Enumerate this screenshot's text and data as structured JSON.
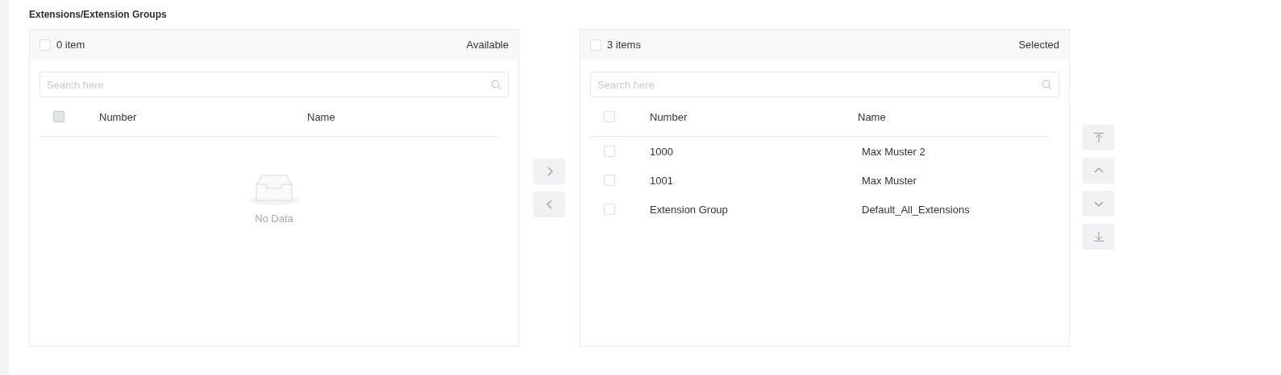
{
  "section_title": "Extensions/Extension Groups",
  "panels": [
    {
      "count": "0 item",
      "title": "Available",
      "checked": false,
      "search": {
        "placeholder": "Search here"
      },
      "columns": [
        "Number",
        "Name"
      ],
      "header_checkbox": {
        "checked": false,
        "disabled": true
      },
      "empty_text": "No Data"
    },
    {
      "count": "3 items",
      "title": "Selected",
      "checked": false,
      "search": {
        "placeholder": "Search here"
      },
      "columns": [
        "Number",
        "Name"
      ],
      "header_checkbox": {
        "checked": false,
        "disabled": false
      },
      "rows": [
        {
          "number": "1000",
          "name": "Max Muster 2",
          "checked": false
        },
        {
          "number": "1001",
          "name": "Max Muster",
          "checked": false
        },
        {
          "number": "Extension Group",
          "name": "Default_All_Extensions",
          "checked": false
        }
      ]
    }
  ],
  "transfer_buttons": [
    {
      "kind": "right",
      "disabled": true
    },
    {
      "kind": "left",
      "disabled": true
    }
  ],
  "order_buttons": [
    {
      "kind": "top",
      "disabled": true
    },
    {
      "kind": "up",
      "disabled": true
    },
    {
      "kind": "down",
      "disabled": true
    },
    {
      "kind": "bottom",
      "disabled": true
    }
  ]
}
